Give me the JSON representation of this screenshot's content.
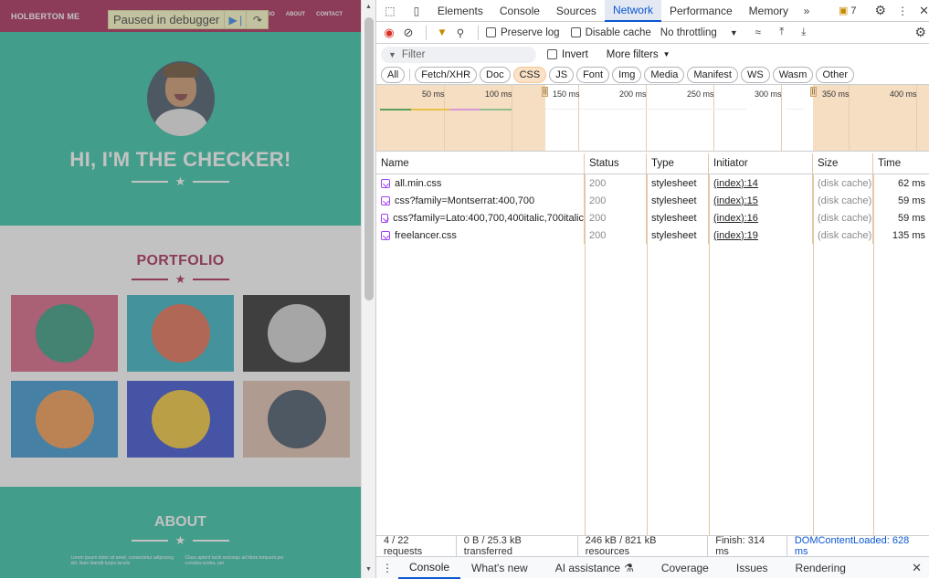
{
  "page": {
    "brand": "HOLBERTON ME",
    "nav_links": [
      "LIO",
      "ABOUT",
      "CONTACT"
    ],
    "paused_text": "Paused in debugger",
    "hero_title": "HI, I'M THE CHECKER!",
    "portfolio_title": "PORTFOLIO",
    "about_title": "ABOUT",
    "about_col1": "Lorem ipsum dolor sit amet, consectetur adipiscing elit. Nam blandit turpis iaculis",
    "about_col2": "Class aptent taciti sociosqu ad litora torquent per conubia nostra, per",
    "tiles": [
      {
        "name": "cabin",
        "bg": "#d44d73",
        "circle": "#1a8a6c"
      },
      {
        "name": "cake",
        "bg": "#1ba8b8",
        "circle": "#e05a3a"
      },
      {
        "name": "circus",
        "bg": "#111111",
        "circle": "#cccccc"
      },
      {
        "name": "game",
        "bg": "#1e87c8",
        "circle": "#f28c38"
      },
      {
        "name": "safe",
        "bg": "#1d37c8",
        "circle": "#f0c020"
      },
      {
        "name": "submarine",
        "bg": "#dfb9a6",
        "circle": "#2c3e50"
      }
    ]
  },
  "devtools": {
    "tabs": [
      "Elements",
      "Console",
      "Sources",
      "Network",
      "Performance",
      "Memory"
    ],
    "active_tab": "Network",
    "issues_count": "7",
    "preserve_log": "Preserve log",
    "disable_cache": "Disable cache",
    "throttling": "No throttling",
    "filter_placeholder": "Filter",
    "invert": "Invert",
    "more_filters": "More filters",
    "types": [
      "All",
      "Fetch/XHR",
      "Doc",
      "CSS",
      "JS",
      "Font",
      "Img",
      "Media",
      "Manifest",
      "WS",
      "Wasm",
      "Other"
    ],
    "active_type": "CSS",
    "timeline_labels": [
      "50 ms",
      "100 ms",
      "150 ms",
      "200 ms",
      "250 ms",
      "300 ms",
      "350 ms",
      "400 ms"
    ],
    "columns": [
      "Name",
      "Status",
      "Type",
      "Initiator",
      "Size",
      "Time"
    ],
    "rows": [
      {
        "name": "all.min.css",
        "status": "200",
        "type": "stylesheet",
        "initiator": "(index):14",
        "size": "(disk cache)",
        "time": "62 ms"
      },
      {
        "name": "css?family=Montserrat:400,700",
        "status": "200",
        "type": "stylesheet",
        "initiator": "(index):15",
        "size": "(disk cache)",
        "time": "59 ms"
      },
      {
        "name": "css?family=Lato:400,700,400italic,700italic",
        "status": "200",
        "type": "stylesheet",
        "initiator": "(index):16",
        "size": "(disk cache)",
        "time": "59 ms"
      },
      {
        "name": "freelancer.css",
        "status": "200",
        "type": "stylesheet",
        "initiator": "(index):19",
        "size": "(disk cache)",
        "time": "135 ms"
      }
    ],
    "status_bar": {
      "requests": "4 / 22 requests",
      "transferred": "0 B / 25.3 kB transferred",
      "resources": "246 kB / 821 kB resources",
      "finish": "Finish: 314 ms",
      "dcl": "DOMContentLoaded: 628 ms"
    },
    "drawer_tabs": [
      "Console",
      "What's new",
      "AI assistance",
      "Coverage",
      "Issues",
      "Rendering"
    ]
  }
}
